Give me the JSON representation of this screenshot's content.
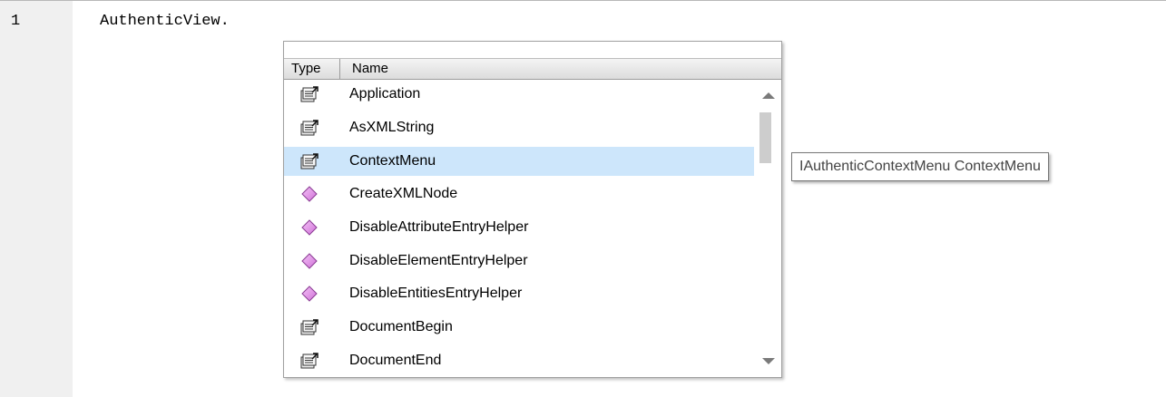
{
  "editor": {
    "line_number": "1",
    "code_line": "AuthenticView."
  },
  "autocomplete": {
    "header": {
      "type_label": "Type",
      "name_label": "Name"
    },
    "items": [
      {
        "label": "Application",
        "icon": "property-icon",
        "selected": false
      },
      {
        "label": "AsXMLString",
        "icon": "property-icon",
        "selected": false
      },
      {
        "label": "ContextMenu",
        "icon": "property-icon",
        "selected": true
      },
      {
        "label": "CreateXMLNode",
        "icon": "method-icon",
        "selected": false
      },
      {
        "label": "DisableAttributeEntryHelper",
        "icon": "method-icon",
        "selected": false
      },
      {
        "label": "DisableElementEntryHelper",
        "icon": "method-icon",
        "selected": false
      },
      {
        "label": "DisableEntitiesEntryHelper",
        "icon": "method-icon",
        "selected": false
      },
      {
        "label": "DocumentBegin",
        "icon": "property-icon",
        "selected": false
      },
      {
        "label": "DocumentEnd",
        "icon": "property-icon",
        "selected": false
      }
    ],
    "scroll_position": 0.12
  },
  "tooltip": {
    "text": "IAuthenticContextMenu ContextMenu"
  },
  "colors": {
    "selection": "#cde6fb",
    "method_icon": "#d070d8",
    "gutter": "#f0f0f0"
  }
}
